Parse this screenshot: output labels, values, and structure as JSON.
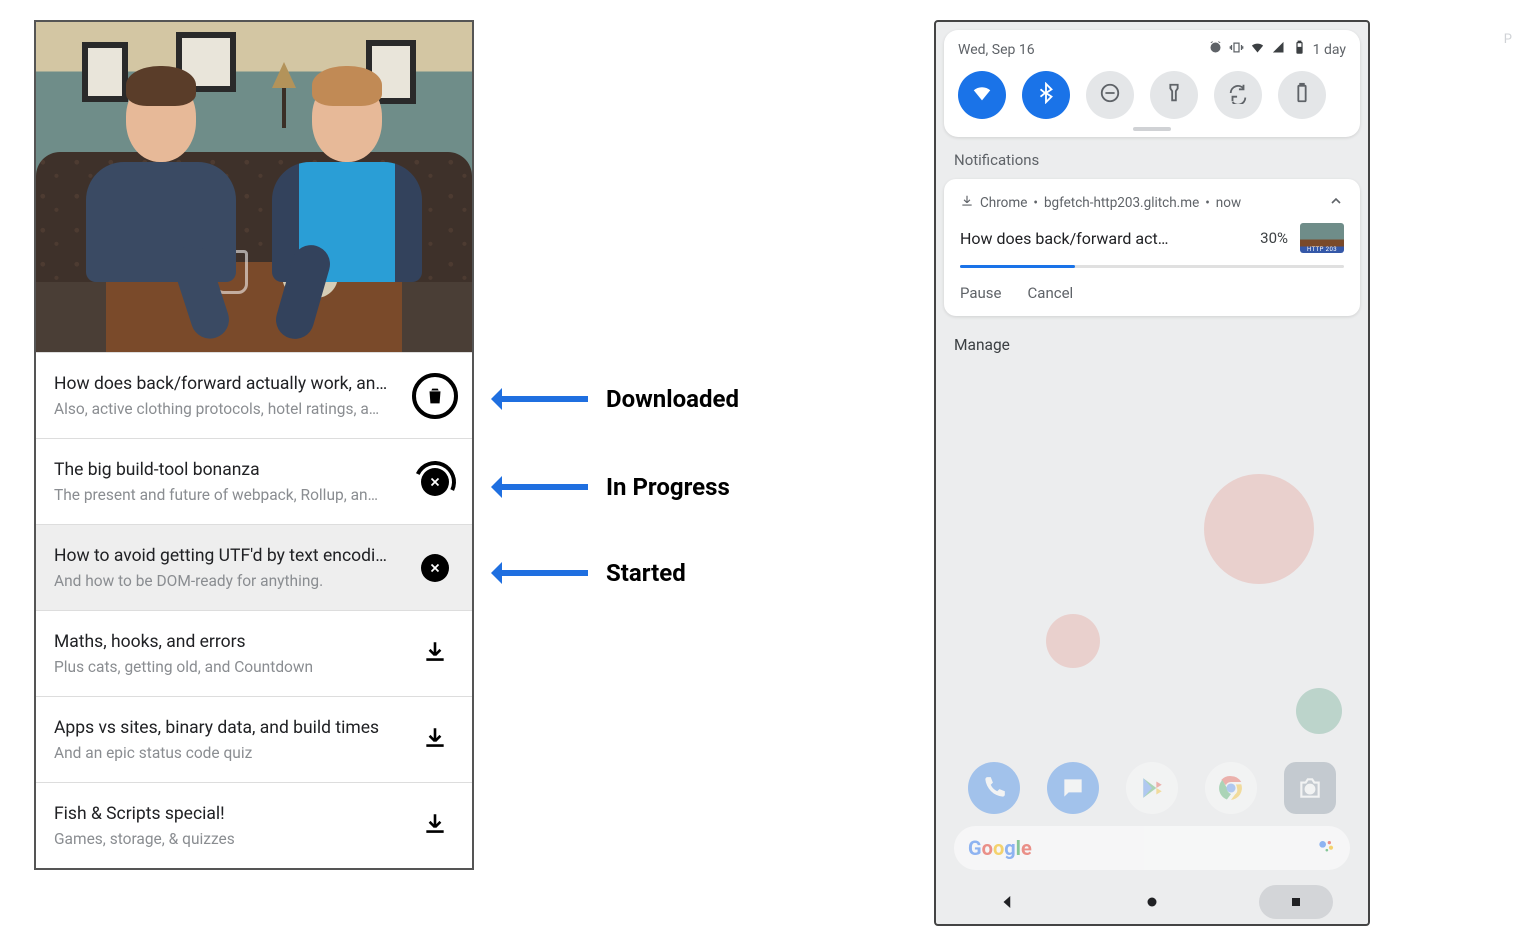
{
  "annotations": {
    "downloaded": "Downloaded",
    "in_progress": "In Progress",
    "started": "Started"
  },
  "app": {
    "episodes": [
      {
        "title": "How does back/forward actually work, an…",
        "subtitle": "Also, active clothing protocols, hotel ratings, a…",
        "state": "downloaded"
      },
      {
        "title": "The big build-tool bonanza",
        "subtitle": "The present and future of webpack, Rollup, an…",
        "state": "in_progress"
      },
      {
        "title": "How to avoid getting UTF'd by text encodi…",
        "subtitle": "And how to be DOM-ready for anything.",
        "state": "started"
      },
      {
        "title": "Maths, hooks, and errors",
        "subtitle": "Plus cats, getting old, and Countdown",
        "state": "idle"
      },
      {
        "title": "Apps vs sites, binary data, and build times",
        "subtitle": "And an epic status code quiz",
        "state": "idle"
      },
      {
        "title": "Fish & Scripts special!",
        "subtitle": "Games, storage, & quizzes",
        "state": "idle"
      }
    ]
  },
  "phone": {
    "status": {
      "date": "Wed, Sep 16",
      "battery_text": "1 day"
    },
    "qs_tiles": [
      {
        "name": "wifi",
        "on": true
      },
      {
        "name": "bluetooth",
        "on": true
      },
      {
        "name": "dnd",
        "on": false
      },
      {
        "name": "flashlight",
        "on": false
      },
      {
        "name": "autorotate",
        "on": false
      },
      {
        "name": "battery-saver",
        "on": false
      }
    ],
    "section_label": "Notifications",
    "notification": {
      "app": "Chrome",
      "source": "bgfetch-http203.glitch.me",
      "time": "now",
      "title": "How does back/forward act…",
      "percent_text": "30%",
      "percent": 30,
      "actions": {
        "pause": "Pause",
        "cancel": "Cancel"
      }
    },
    "manage": "Manage",
    "search_letters": [
      "G",
      "o",
      "o",
      "g",
      "l",
      "e"
    ]
  },
  "watermark": "P"
}
